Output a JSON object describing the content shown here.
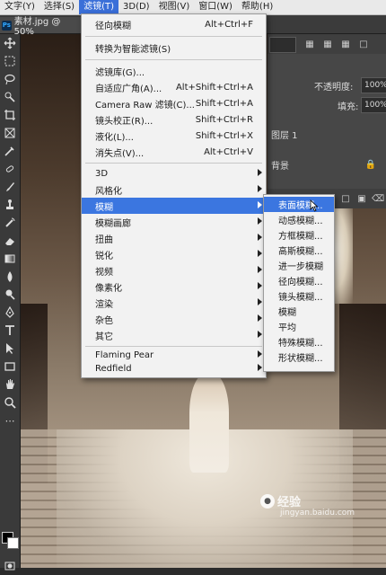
{
  "menubar": {
    "items": [
      {
        "label": "文字(Y)",
        "active": false
      },
      {
        "label": "选择(S)",
        "active": false
      },
      {
        "label": "滤镜(T)",
        "active": true
      },
      {
        "label": "3D(D)",
        "active": false
      },
      {
        "label": "视图(V)",
        "active": false
      },
      {
        "label": "窗口(W)",
        "active": false
      },
      {
        "label": "帮助(H)",
        "active": false
      }
    ]
  },
  "document_tab": {
    "ps_badge": "Ps",
    "label": "素材.jpg @ 50%"
  },
  "filter_menu": {
    "items": [
      {
        "label": "径向模糊",
        "shortcut": "Alt+Ctrl+F"
      },
      {
        "label": "转换为智能滤镜(S)",
        "shortcut": ""
      },
      {
        "label": "滤镜库(G)...",
        "shortcut": ""
      },
      {
        "label": "自适应广角(A)...",
        "shortcut": "Alt+Shift+Ctrl+A"
      },
      {
        "label": "Camera Raw 滤镜(C)...",
        "shortcut": "Shift+Ctrl+A"
      },
      {
        "label": "镜头校正(R)...",
        "shortcut": "Shift+Ctrl+R"
      },
      {
        "label": "液化(L)...",
        "shortcut": "Shift+Ctrl+X"
      },
      {
        "label": "消失点(V)...",
        "shortcut": "Alt+Ctrl+V"
      },
      {
        "label": "3D",
        "shortcut": ""
      },
      {
        "label": "风格化",
        "shortcut": ""
      },
      {
        "label": "模糊",
        "shortcut": ""
      },
      {
        "label": "模糊画廊",
        "shortcut": ""
      },
      {
        "label": "扭曲",
        "shortcut": ""
      },
      {
        "label": "锐化",
        "shortcut": ""
      },
      {
        "label": "视频",
        "shortcut": ""
      },
      {
        "label": "像素化",
        "shortcut": ""
      },
      {
        "label": "渲染",
        "shortcut": ""
      },
      {
        "label": "杂色",
        "shortcut": ""
      },
      {
        "label": "其它",
        "shortcut": ""
      },
      {
        "label": "Flaming Pear",
        "shortcut": ""
      },
      {
        "label": "Redfield",
        "shortcut": ""
      }
    ],
    "highlighted": "模糊"
  },
  "blur_submenu": {
    "items": [
      "表面模糊...",
      "动感模糊...",
      "方框模糊...",
      "高斯模糊...",
      "进一步模糊",
      "径向模糊...",
      "镜头模糊...",
      "模糊",
      "平均",
      "特殊模糊...",
      "形状模糊..."
    ],
    "highlighted": "表面模糊..."
  },
  "panel": {
    "opacity_label": "不透明度:",
    "opacity_value": "100%",
    "fill_label": "填充:",
    "fill_value": "100%",
    "layer1_label": "图层 1",
    "background_label": "背景"
  },
  "watermark": {
    "text": "经验",
    "url": "jingyan.baidu.com"
  },
  "colors": {
    "accent": "#3b76e0",
    "menu_bg": "#f2f2f2",
    "foreground": "#000000",
    "background": "#ffffff"
  }
}
